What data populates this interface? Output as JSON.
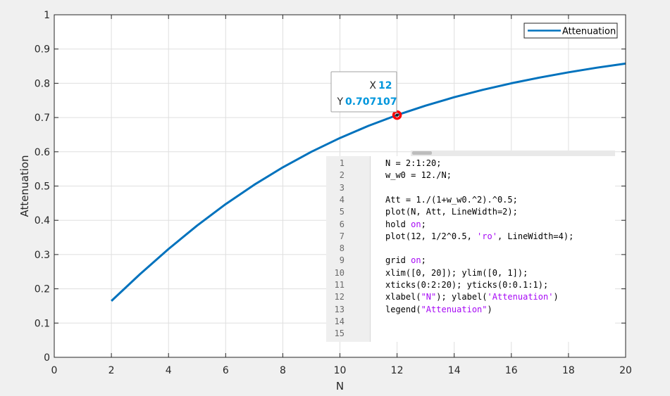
{
  "chart_data": {
    "type": "line",
    "xlabel": "N",
    "ylabel": "Attenuation",
    "xlim": [
      0,
      20
    ],
    "ylim": [
      0,
      1
    ],
    "xticks": [
      0,
      2,
      4,
      6,
      8,
      10,
      12,
      14,
      16,
      18,
      20
    ],
    "yticks": [
      0,
      0.1,
      0.2,
      0.3,
      0.4,
      0.5,
      0.6,
      0.7,
      0.8,
      0.9,
      1
    ],
    "grid": true,
    "legend_position": "top-right",
    "series": [
      {
        "name": "Attenuation",
        "color": "#0072bd",
        "x": [
          2,
          3,
          4,
          5,
          6,
          7,
          8,
          9,
          10,
          11,
          12,
          13,
          14,
          15,
          16,
          17,
          18,
          19,
          20
        ],
        "y": [
          0.1644,
          0.2425,
          0.3162,
          0.3846,
          0.4472,
          0.5036,
          0.5547,
          0.6,
          0.6402,
          0.6757,
          0.7071,
          0.7348,
          0.7593,
          0.7809,
          0.8,
          0.8169,
          0.8321,
          0.8456,
          0.8575
        ]
      }
    ],
    "marker": {
      "x": 12,
      "y": 0.707107,
      "color": "#ff0000"
    },
    "datatip": {
      "x_label": "X",
      "x_value": "12",
      "y_label": "Y",
      "y_value": "0.707107"
    }
  },
  "code": {
    "lines": [
      {
        "n": "1",
        "parts": [
          {
            "t": "N = 2:1:20;",
            "c": ""
          }
        ]
      },
      {
        "n": "2",
        "parts": [
          {
            "t": "w_w0 = 12./N;",
            "c": ""
          }
        ]
      },
      {
        "n": "3",
        "parts": []
      },
      {
        "n": "4",
        "parts": [
          {
            "t": "Att = 1./(1+w_w0.^2).^0.5;",
            "c": ""
          }
        ]
      },
      {
        "n": "5",
        "parts": [
          {
            "t": "plot(N, Att, LineWidth=2);",
            "c": ""
          }
        ]
      },
      {
        "n": "6",
        "parts": [
          {
            "t": "hold ",
            "c": ""
          },
          {
            "t": "on",
            "c": "str"
          },
          {
            "t": ";",
            "c": ""
          }
        ]
      },
      {
        "n": "7",
        "parts": [
          {
            "t": "plot(12, 1/2^0.5, ",
            "c": ""
          },
          {
            "t": "'ro'",
            "c": "str"
          },
          {
            "t": ", LineWidth=4);",
            "c": ""
          }
        ]
      },
      {
        "n": "8",
        "parts": []
      },
      {
        "n": "9",
        "parts": [
          {
            "t": "grid ",
            "c": ""
          },
          {
            "t": "on",
            "c": "str"
          },
          {
            "t": ";",
            "c": ""
          }
        ]
      },
      {
        "n": "10",
        "parts": [
          {
            "t": "xlim([0, 20]); ylim([0, 1]);",
            "c": ""
          }
        ]
      },
      {
        "n": "11",
        "parts": [
          {
            "t": "xticks(0:2:20); yticks(0:0.1:1);",
            "c": ""
          }
        ]
      },
      {
        "n": "12",
        "parts": [
          {
            "t": "xlabel(",
            "c": ""
          },
          {
            "t": "\"N\"",
            "c": "str"
          },
          {
            "t": "); ylabel(",
            "c": ""
          },
          {
            "t": "'Attenuation'",
            "c": "str"
          },
          {
            "t": ")",
            "c": ""
          }
        ]
      },
      {
        "n": "13",
        "parts": [
          {
            "t": "legend(",
            "c": ""
          },
          {
            "t": "\"Attenuation\"",
            "c": "str"
          },
          {
            "t": ")",
            "c": ""
          }
        ]
      },
      {
        "n": "14",
        "parts": []
      },
      {
        "n": "15",
        "parts": []
      }
    ]
  }
}
